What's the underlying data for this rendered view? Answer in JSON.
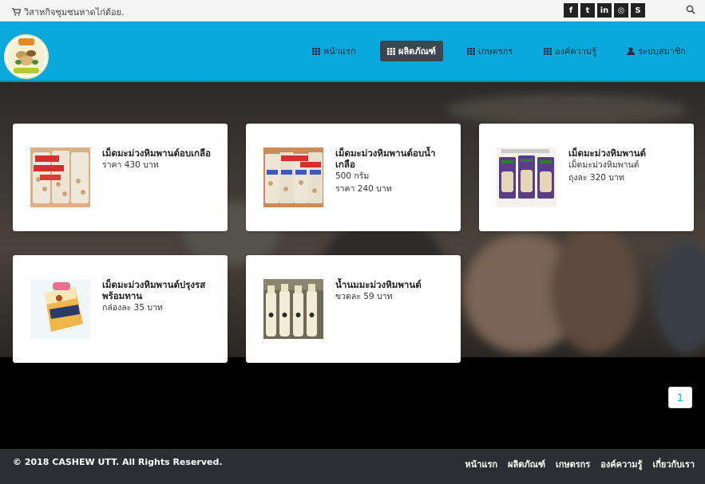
{
  "topbar": {
    "tagline": "วิสาหกิจชุมชนหาดไก่ต้อย.",
    "cart_icon": "cart-icon",
    "social": [
      {
        "icon": "facebook-icon",
        "glyph": "f"
      },
      {
        "icon": "twitter-icon",
        "glyph": "t"
      },
      {
        "icon": "linkedin-icon",
        "glyph": "in"
      },
      {
        "icon": "dribbble-icon",
        "glyph": "◎"
      },
      {
        "icon": "skype-icon",
        "glyph": "S"
      }
    ],
    "search_icon": "search-icon"
  },
  "nav": {
    "items": [
      {
        "label": "หน้าแรก"
      },
      {
        "label": "ผลิตภัณฑ์"
      },
      {
        "label": "เกษตรกร"
      },
      {
        "label": "องค์ความรู้"
      },
      {
        "label": "ระบบสมาชิก"
      }
    ]
  },
  "products": [
    {
      "name": "เม็ดมะม่วงหิมพานต์อบเกลือ",
      "lines": [
        "ราคา 430 บาท"
      ]
    },
    {
      "name": "เม็ดมะม่วงหิมพานต์อบน้ำเกลือ",
      "lines": [
        "500 กรัม",
        "ราคา 240 บาท"
      ]
    },
    {
      "name": "เม็ดมะม่วงหิมพานต์",
      "lines": [
        "เม็ดมะม่วงหิมพานต์",
        "ถุงละ 320 บาท"
      ]
    },
    {
      "name": "เม็ดมะม่วงหิมพานต์ปรุงรสพร้อมทาน",
      "lines": [
        "กล่องละ 35 บาท"
      ]
    },
    {
      "name": "น้ำนมมะม่วงหิมพานต์",
      "lines": [
        "ขวดละ 59 บาท"
      ]
    }
  ],
  "pagination": {
    "current": "1"
  },
  "footer": {
    "copyright": "© 2018 CASHEW UTT. All Rights Reserved.",
    "links": [
      "หน้าแรก",
      "ผลิตภัณฑ์",
      "เกษตรกร",
      "องค์ความรู้",
      "เกี่ยวกับเรา"
    ]
  },
  "colors": {
    "navbar": "#08a8dc",
    "active_nav": "#3c4650",
    "footer": "#2b2f33"
  }
}
